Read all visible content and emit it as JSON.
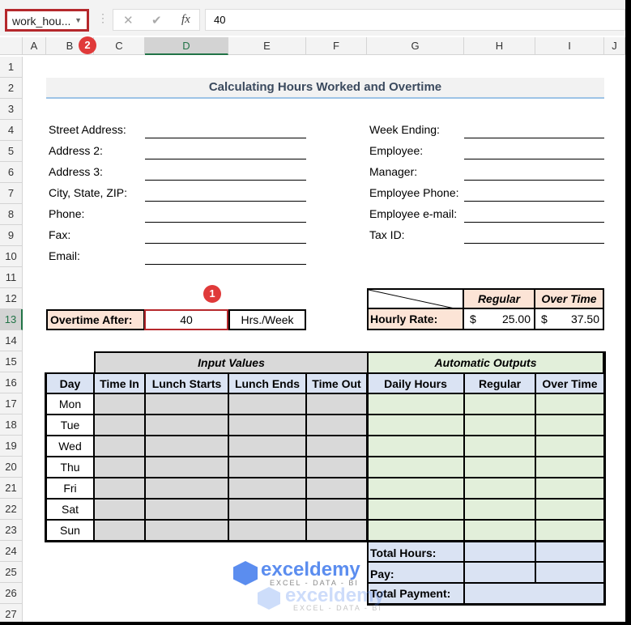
{
  "formula_bar": {
    "name_box": "work_hou...",
    "cancel_icon": "✕",
    "enter_icon": "✔",
    "fx_label": "fx",
    "formula": "40"
  },
  "columns": [
    "A",
    "B",
    "C",
    "D",
    "E",
    "F",
    "G",
    "H",
    "I",
    "J"
  ],
  "rows": [
    "1",
    "2",
    "3",
    "4",
    "5",
    "6",
    "7",
    "8",
    "9",
    "10",
    "11",
    "12",
    "13",
    "14",
    "15",
    "16",
    "17",
    "18",
    "19",
    "20",
    "21",
    "22",
    "23",
    "24",
    "25",
    "26",
    "27"
  ],
  "title": "Calculating Hours Worked and Overtime",
  "left_fields": [
    "Street Address:",
    "Address 2:",
    "Address 3:",
    "City, State, ZIP:",
    "Phone:",
    "Fax:",
    "Email:"
  ],
  "right_fields": [
    "Week Ending:",
    "Employee:",
    "Manager:",
    "Employee Phone:",
    "Employee e-mail:",
    "Tax ID:"
  ],
  "overtime": {
    "label": "Overtime After:",
    "value": "40",
    "unit": "Hrs./Week"
  },
  "rates": {
    "regular_header": "Regular",
    "overtime_header": "Over Time",
    "label": "Hourly Rate:",
    "currency": "$",
    "regular": "25.00",
    "overtime": "37.50"
  },
  "schedule": {
    "input_header": "Input Values",
    "output_header": "Automatic Outputs",
    "headers": [
      "Day",
      "Time In",
      "Lunch Starts",
      "Lunch Ends",
      "Time Out",
      "Daily Hours",
      "Regular",
      "Over Time"
    ],
    "days": [
      "Mon",
      "Tue",
      "Wed",
      "Thu",
      "Fri",
      "Sat",
      "Sun"
    ]
  },
  "totals": {
    "hours": "Total Hours:",
    "pay": "Pay:",
    "payment": "Total Payment:"
  },
  "badges": [
    "1",
    "2"
  ],
  "watermark": {
    "name": "exceldemy",
    "tagline": "EXCEL - DATA - BI"
  }
}
